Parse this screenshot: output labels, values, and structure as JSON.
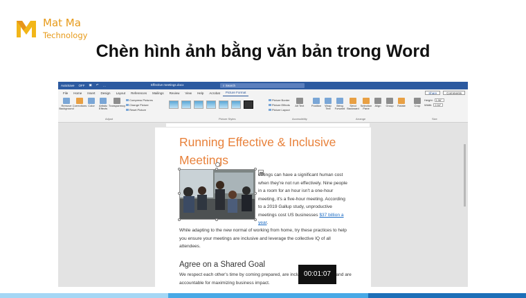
{
  "brand": {
    "name": "Mat Ma",
    "subtitle": "Technology",
    "color": "#e79a19"
  },
  "heading": "Chèn hình ảnh bằng văn bản trong Word",
  "word": {
    "titlebar": {
      "autosave": "AutoSave",
      "autosave_state": "OFF",
      "document": "Effective meetings.docx",
      "search_placeholder": "Search"
    },
    "menu": [
      "File",
      "Home",
      "Insert",
      "Design",
      "Layout",
      "References",
      "Mailings",
      "Review",
      "View",
      "Help",
      "Acrobat",
      "Picture Format"
    ],
    "active_menu": "Picture Format",
    "share_label": "Share",
    "comments_label": "Comments",
    "ribbon": {
      "remove_background": "Remove Background",
      "corrections": "Corrections",
      "color": "Color",
      "artistic_effects": "Artistic Effects",
      "transparency": "Transparency",
      "compress_pictures": "Compress Pictures",
      "change_picture": "Change Picture",
      "reset_picture": "Reset Picture",
      "adjust_label": "Adjust",
      "picture_styles_label": "Picture Styles",
      "picture_border": "Picture Border",
      "picture_effects": "Picture Effects",
      "picture_layout": "Picture Layout",
      "alt_text": "Alt Text",
      "accessibility_label": "Accessibility",
      "position": "Position",
      "wrap_text": "Wrap Text",
      "bring_forward": "Bring Forward",
      "send_backward": "Send Backward",
      "selection_pane": "Selection Pane",
      "align": "Align",
      "group": "Group",
      "rotate": "Rotate",
      "arrange_label": "Arrange",
      "crop": "Crop",
      "height_label": "Height:",
      "height_value": "1.96\"",
      "width_label": "Width:",
      "width_value": "2.94\"",
      "size_label": "Size"
    }
  },
  "document": {
    "title": "Running Effective & Inclusive Meetings",
    "side_text": "eetings can have a significant human cost when they're not run effectively. Nine people in a room for an hour isn't a one-hour meeting, it's a five-hour meeting. According to a 2019 Gallup study, unproductive meetings cost US businesses",
    "side_link": "$37 billion a year",
    "side_link_suffix": ".",
    "main_text": "While adapting to the new normal of working from home, try these practices to help you ensure your meetings are inclusive and leverage the collective IQ of all attendees.",
    "section_heading": "Agree on a Shared Goal",
    "section_text": "We respect each other's time by coming prepared, are inclu",
    "section_text_tail": "es, and are accountable for maximizing business impact.",
    "title_color": "#e8813a"
  },
  "video_timer": "00:01:07",
  "colors": {
    "word_blue": "#2c5aa0",
    "bar_light": "#a5d7f5",
    "bar_mid": "#48a9e6",
    "bar_dark": "#1d6fb8"
  }
}
